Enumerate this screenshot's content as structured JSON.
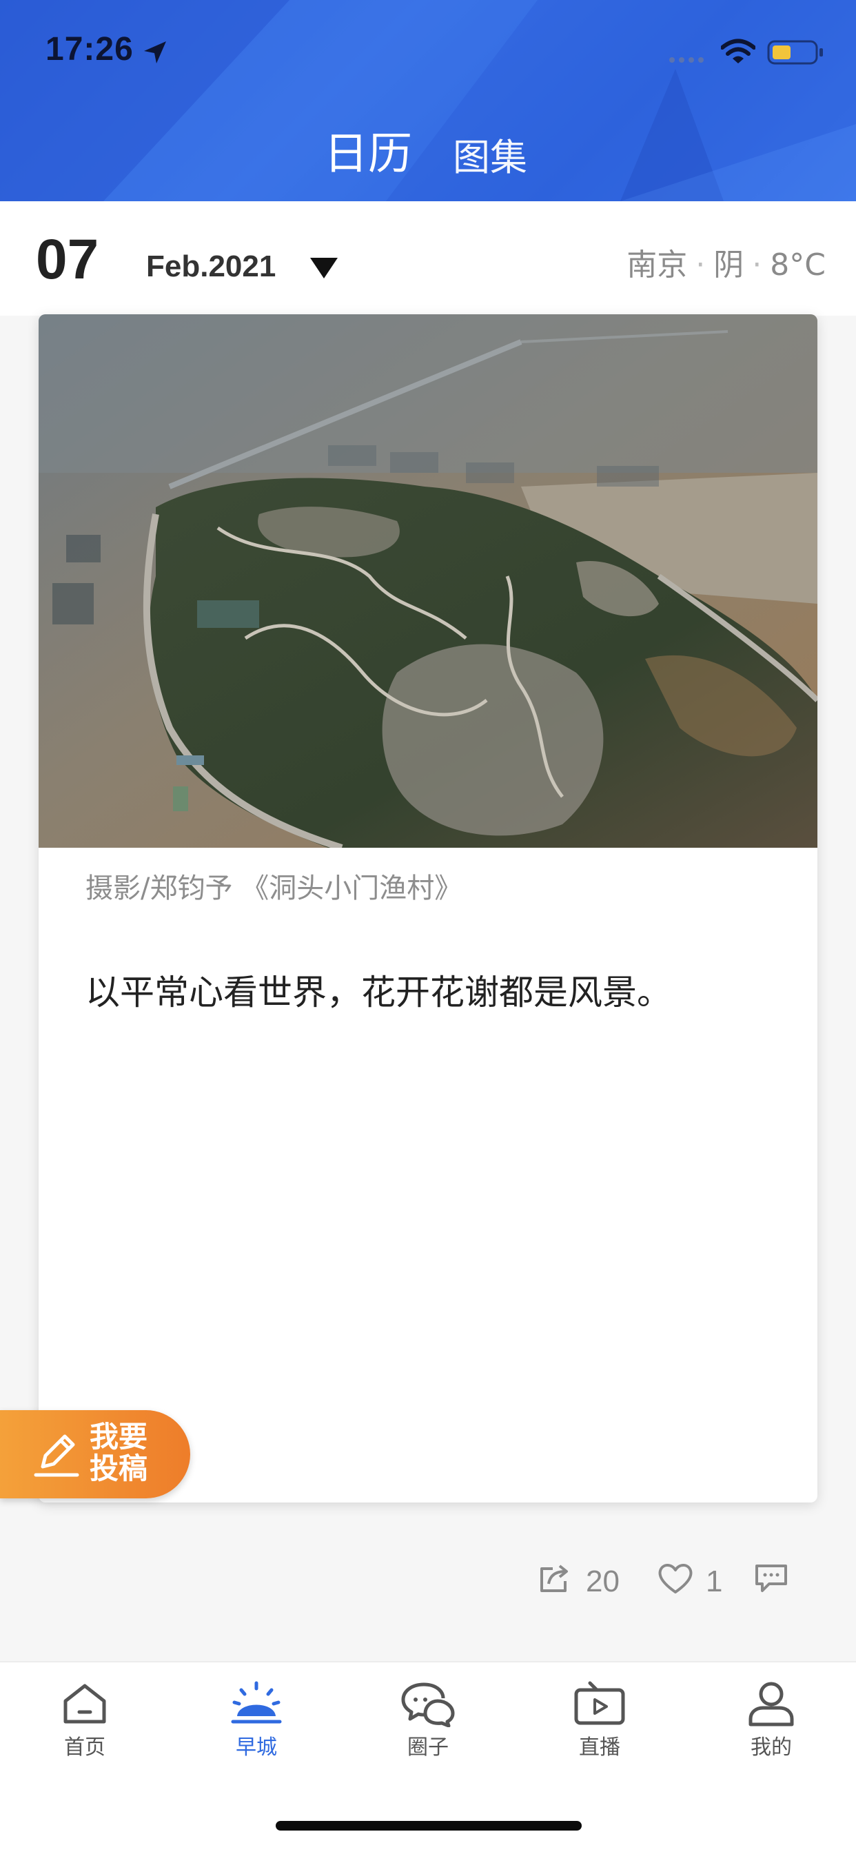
{
  "status_bar": {
    "time": "17:26",
    "icons": [
      "location-arrow-icon",
      "signal-dots-icon",
      "wifi-icon",
      "battery-icon"
    ]
  },
  "header": {
    "tabs": [
      {
        "label": "日历",
        "active": true
      },
      {
        "label": "图集",
        "active": false
      }
    ],
    "background_color": "#2f66de"
  },
  "date_bar": {
    "day": "07",
    "month_year": "Feb.2021",
    "toggle_icon": "caret-down-icon",
    "city": "南京",
    "weather": "阴",
    "temperature": "8°C"
  },
  "card": {
    "photo_icon": "aerial-island-photo",
    "credit": "摄影/郑钧予 《洞头小门渔村》",
    "quote": "以平常心看世界，花开花谢都是风景。"
  },
  "submit_button": {
    "line1": "我要",
    "line2": "投稿",
    "icon": "pen-icon",
    "colors": [
      "#f4a13a",
      "#ee7d2a"
    ]
  },
  "actions": {
    "share_count": "20",
    "like_count": "1",
    "icons": [
      "share-icon",
      "heart-icon",
      "comment-icon"
    ]
  },
  "tab_bar": {
    "items": [
      {
        "label": "首页",
        "icon": "home-icon",
        "active": false
      },
      {
        "label": "早城",
        "icon": "sunrise-icon",
        "active": true
      },
      {
        "label": "圈子",
        "icon": "chat-bubbles-icon",
        "active": false
      },
      {
        "label": "直播",
        "icon": "tv-play-icon",
        "active": false
      },
      {
        "label": "我的",
        "icon": "user-icon",
        "active": false
      }
    ],
    "active_color": "#2f6ae0"
  }
}
